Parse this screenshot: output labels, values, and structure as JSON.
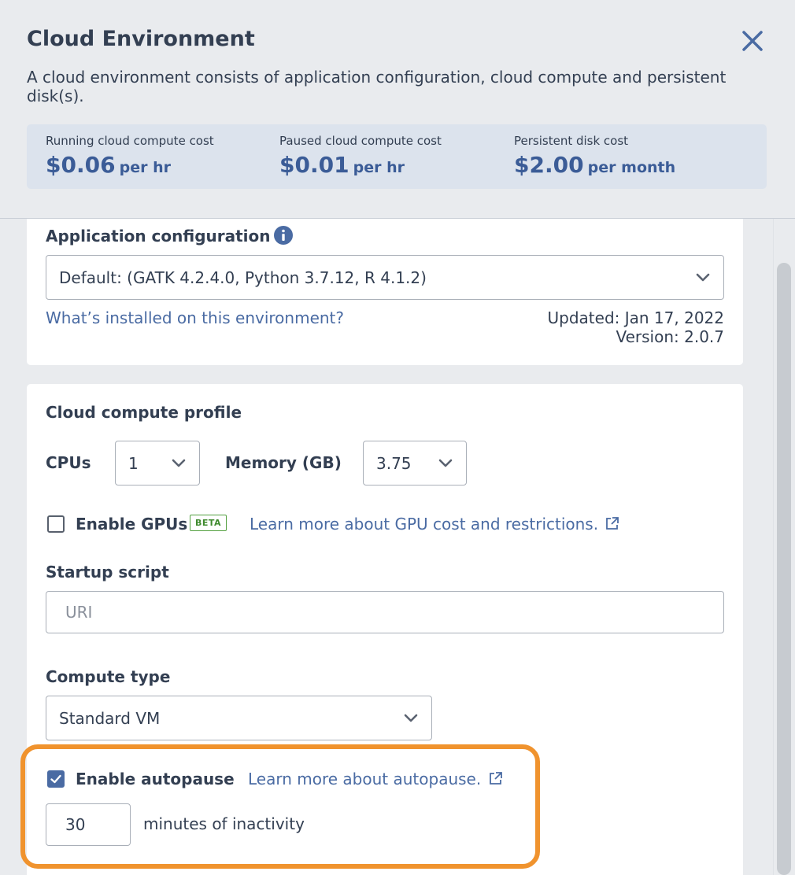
{
  "header": {
    "title": "Cloud Environment",
    "description": "A cloud environment consists of application configuration, cloud compute and persistent disk(s)."
  },
  "costs": [
    {
      "label": "Running cloud compute cost",
      "amount": "$0.06",
      "unit": "per hr"
    },
    {
      "label": "Paused cloud compute cost",
      "amount": "$0.01",
      "unit": "per hr"
    },
    {
      "label": "Persistent disk cost",
      "amount": "$2.00",
      "unit": "per month"
    }
  ],
  "app_config": {
    "label": "Application configuration",
    "selected": "Default: (GATK 4.2.4.0, Python 3.7.12, R 4.1.2)",
    "link": "What’s installed on this environment?",
    "updated": "Updated: Jan 17, 2022",
    "version": "Version: 2.0.7"
  },
  "compute_profile": {
    "label": "Cloud compute profile",
    "cpus_label": "CPUs",
    "cpus_value": "1",
    "memory_label": "Memory (GB)",
    "memory_value": "3.75",
    "gpu_label": "Enable GPUs",
    "gpu_checked": false,
    "beta_badge": "BETA",
    "gpu_link": "Learn more about GPU cost and restrictions.",
    "startup_label": "Startup script",
    "startup_placeholder": "URI",
    "compute_type_label": "Compute type",
    "compute_type_value": "Standard VM",
    "autopause_label": "Enable autopause",
    "autopause_checked": true,
    "autopause_link": "Learn more about autopause.",
    "autopause_minutes": "30",
    "autopause_suffix": "minutes of inactivity"
  },
  "colors": {
    "accent": "#4a6ba3",
    "highlight": "#f0932e",
    "beta": "#53a040"
  },
  "icons": {
    "close": "close-icon",
    "info": "info-icon",
    "chevron": "chevron-down-icon",
    "external": "external-link-icon",
    "check": "check-icon"
  }
}
